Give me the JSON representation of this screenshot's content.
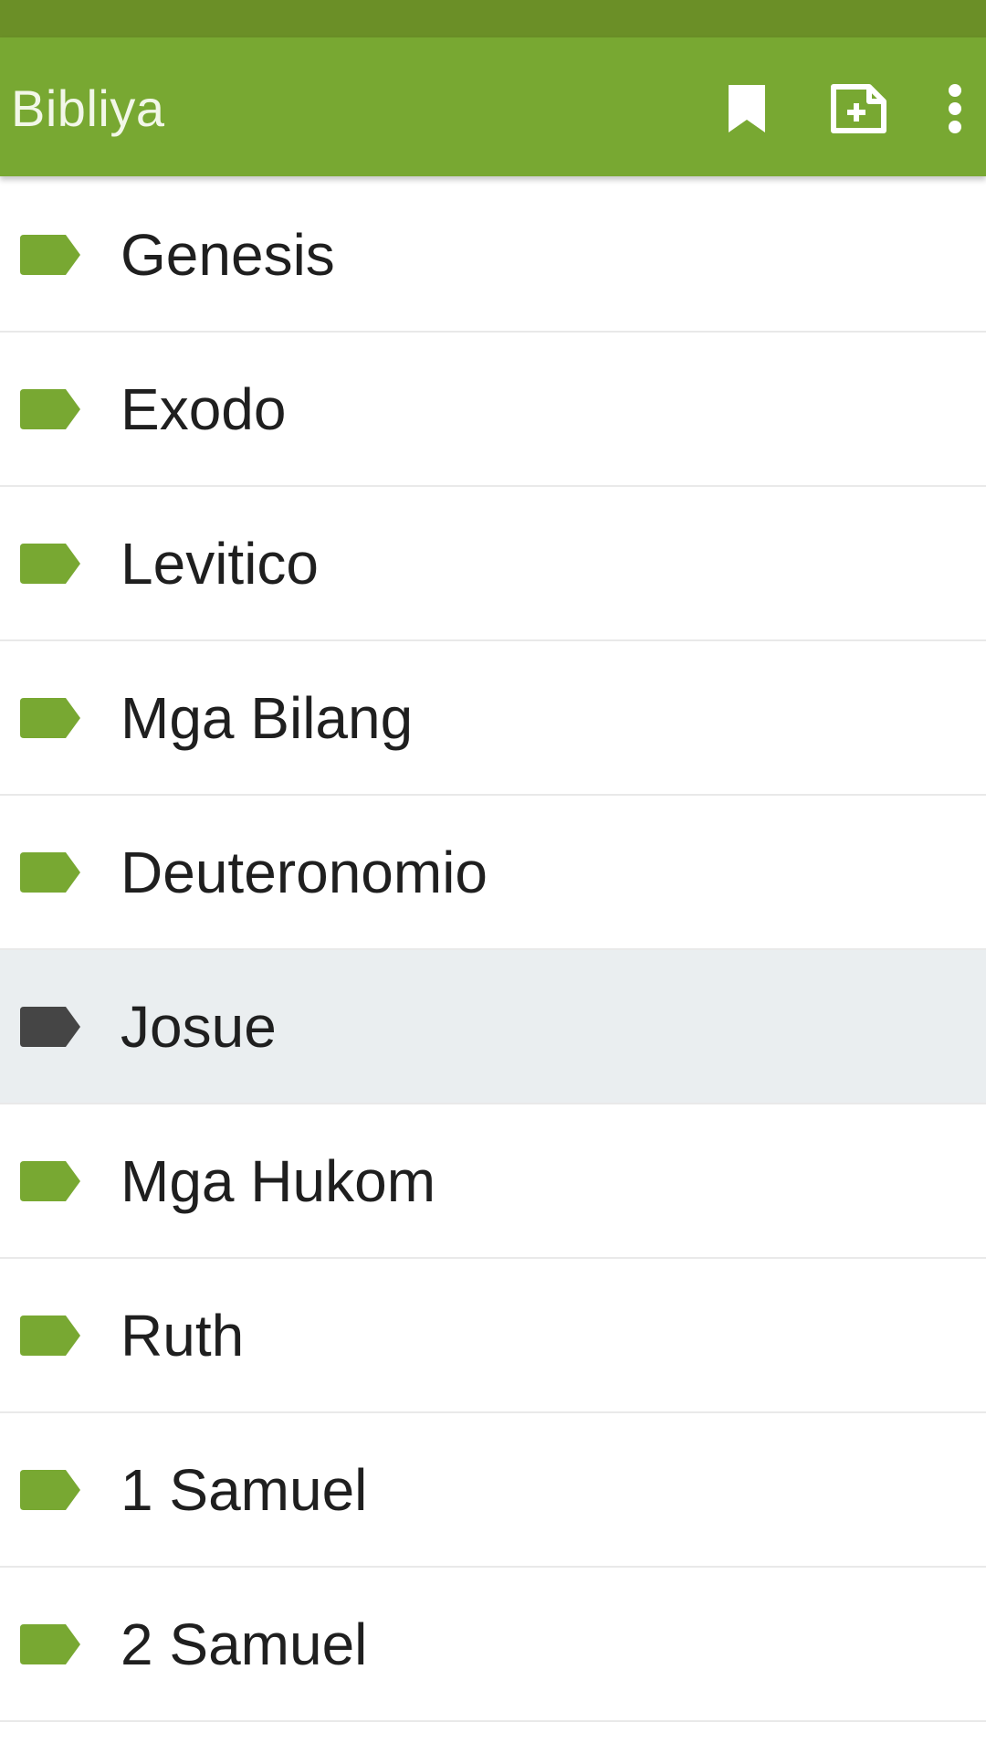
{
  "app": {
    "title": "Bibliya",
    "actions": [
      {
        "icon": "bookmark-icon"
      },
      {
        "icon": "note-add-icon"
      },
      {
        "icon": "more-vert-icon"
      }
    ]
  },
  "colors": {
    "primary": "#78a832",
    "status_bar": "#6b8f27",
    "tag": "#78a832",
    "tag_selected": "#454545",
    "selected_row_bg": "#eaeef0"
  },
  "books": [
    {
      "label": "Genesis",
      "selected": false
    },
    {
      "label": "Exodo",
      "selected": false
    },
    {
      "label": "Levitico",
      "selected": false
    },
    {
      "label": "Mga Bilang",
      "selected": false
    },
    {
      "label": "Deuteronomio",
      "selected": false
    },
    {
      "label": "Josue",
      "selected": true
    },
    {
      "label": "Mga Hukom",
      "selected": false
    },
    {
      "label": "Ruth",
      "selected": false
    },
    {
      "label": "1 Samuel",
      "selected": false
    },
    {
      "label": "2 Samuel",
      "selected": false
    }
  ]
}
